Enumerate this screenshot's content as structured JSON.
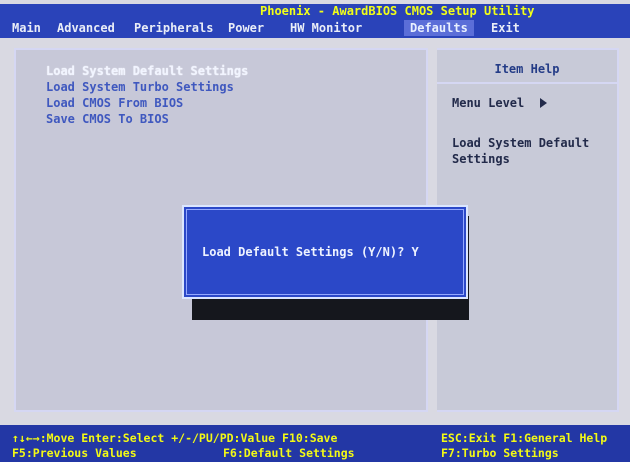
{
  "title": "Phoenix - AwardBIOS CMOS Setup Utility",
  "menu": [
    {
      "label": "Main",
      "active": false
    },
    {
      "label": "Advanced",
      "active": false
    },
    {
      "label": "Peripherals",
      "active": false
    },
    {
      "label": "Power",
      "active": false
    },
    {
      "label": "HW Monitor",
      "active": false
    },
    {
      "label": "Defaults",
      "active": true
    },
    {
      "label": "Exit",
      "active": false
    }
  ],
  "main": {
    "items": [
      {
        "label": "Load System Default Settings",
        "selected": true
      },
      {
        "label": "Load System Turbo Settings",
        "selected": false
      },
      {
        "label": "Load CMOS From BIOS",
        "selected": false
      },
      {
        "label": "Save CMOS To BIOS",
        "selected": false
      }
    ]
  },
  "help": {
    "header": "Item Help",
    "menu_level_label": "Menu Level",
    "description_lines": [
      "Load System Default",
      "Settings"
    ]
  },
  "dialog": {
    "text": "Load Default Settings (Y/N)? Y"
  },
  "footer": {
    "line1_left": "↑↓←→:Move  Enter:Select  +/-/PU/PD:Value  F10:Save",
    "line1_right": "ESC:Exit  F1:General Help",
    "line2_left": "F5:Previous Values",
    "line2_mid": "F6:Default Settings",
    "line2_right": "F7:Turbo Settings"
  },
  "colors": {
    "accent_blue": "#2a43b9",
    "dialog_blue": "#2b48c8",
    "footer_yellow": "#f3fa15",
    "title_yellow": "#f2ff18",
    "menu_text": "#e9edf7",
    "item_text": "#3f58bf"
  }
}
